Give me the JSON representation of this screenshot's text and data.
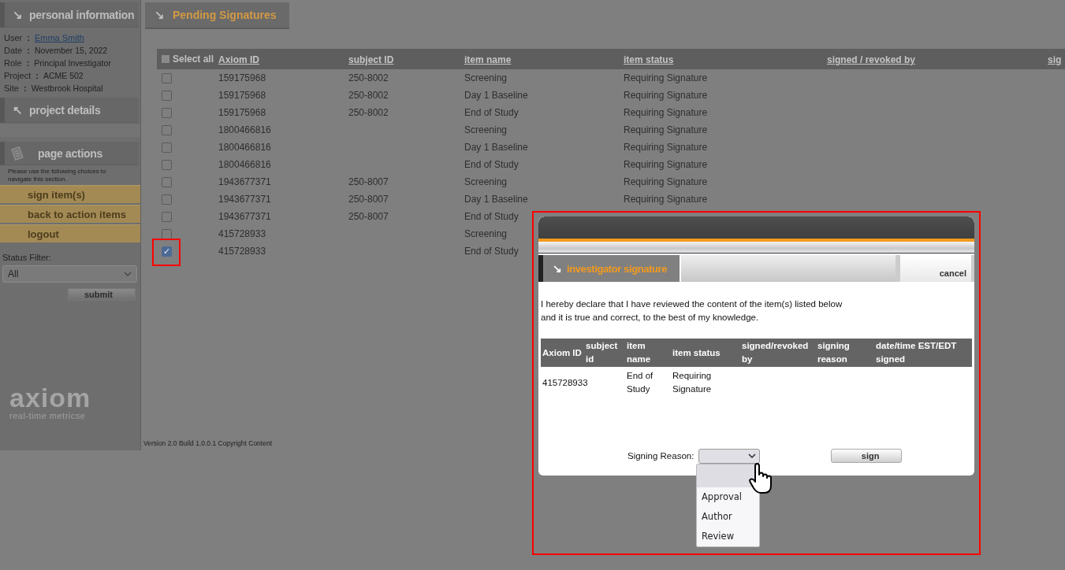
{
  "sidebar": {
    "personal_icon": "↘",
    "personal_header": "personal information",
    "separator": ":",
    "info": [
      {
        "label": "User",
        "value": "Emma Smith",
        "kind": "link"
      },
      {
        "label": "Date",
        "value": "November 15, 2022",
        "kind": "text"
      },
      {
        "label": "Role",
        "value": "Principal Investigator",
        "kind": "text"
      },
      {
        "label": "Project",
        "value": "ACME 502",
        "kind": "text"
      },
      {
        "label": "Site",
        "value": "Westbrook Hospital",
        "kind": "text"
      }
    ],
    "project_icon": "↖",
    "project_header": "project details",
    "actions_header": "page actions",
    "actions_note": "Please use the following choices to navigate this section.",
    "actions": [
      "sign item(s)",
      "back to action items",
      "logout"
    ],
    "status_filter_label": "Status Filter:",
    "status_filter_value": "All",
    "submit": "submit",
    "logo": "axiom",
    "tagline": "real-time metricse"
  },
  "page_tab_icon": "↘",
  "page_tab": "Pending Signatures",
  "table": {
    "select_all": "Select all",
    "select_all_checked": false,
    "check_glyph": "✓",
    "columns": [
      "Axiom ID",
      "subject ID",
      "item name",
      "item status",
      "signed / revoked by",
      "sig"
    ],
    "rows": [
      {
        "checked": false,
        "axiom_id": "159175968",
        "subject_id": "250-8002",
        "item_name": "Screening",
        "item_status": "Requiring Signature"
      },
      {
        "checked": false,
        "axiom_id": "159175968",
        "subject_id": "250-8002",
        "item_name": "Day 1 Baseline",
        "item_status": "Requiring Signature"
      },
      {
        "checked": false,
        "axiom_id": "159175968",
        "subject_id": "250-8002",
        "item_name": "End of Study",
        "item_status": "Requiring Signature"
      },
      {
        "checked": false,
        "axiom_id": "1800466816",
        "item_name": "Screening",
        "item_status": "Requiring Signature"
      },
      {
        "checked": false,
        "axiom_id": "1800466816",
        "item_name": "Day 1 Baseline",
        "item_status": "Requiring Signature"
      },
      {
        "checked": false,
        "axiom_id": "1800466816",
        "item_name": "End of Study",
        "item_status": "Requiring Signature"
      },
      {
        "checked": false,
        "axiom_id": "1943677371",
        "subject_id": "250-8007",
        "item_name": "Screening",
        "item_status": "Requiring Signature"
      },
      {
        "checked": false,
        "axiom_id": "1943677371",
        "subject_id": "250-8007",
        "item_name": "Day 1 Baseline",
        "item_status": "Requiring Signature"
      },
      {
        "checked": false,
        "axiom_id": "1943677371",
        "subject_id": "250-8007",
        "item_name": "End of Study"
      },
      {
        "checked": false,
        "axiom_id": "415728933",
        "item_name": "Screening"
      },
      {
        "checked": true,
        "axiom_id": "415728933",
        "item_name": "End of Study"
      }
    ]
  },
  "footer": "Version  2.0 Build 1.0.0.1  Copyright Content",
  "dialog": {
    "tab_icon": "↘",
    "tab": "investigator signature",
    "cancel": "cancel",
    "declaration": [
      "I hereby declare that I have reviewed the content of the item(s) listed below",
      "and it is true and correct, to the best of my knowledge."
    ],
    "columns": [
      "Axiom ID",
      "subject id",
      "item name",
      "item status",
      "signed/revoked by",
      "signing reason",
      "date/time EST/EDT signed"
    ],
    "rows": [
      {
        "axiom_id": "415728933",
        "item_name": "End of Study",
        "item_status": "Requiring Signature"
      }
    ],
    "reason_label": "Signing Reason:",
    "sign": "sign",
    "reason_options": [
      {
        "selected": true
      },
      {
        "label": "Approval",
        "selected": false
      },
      {
        "label": "Author",
        "selected": false
      },
      {
        "label": "Review",
        "selected": false
      }
    ]
  }
}
